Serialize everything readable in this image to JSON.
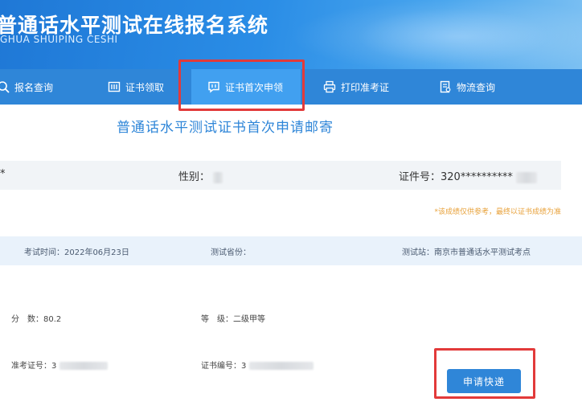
{
  "banner": {
    "title": "普通话水平测试在线报名系统",
    "subtitle": "GHUA SHUIPING CESHI"
  },
  "nav": {
    "items": [
      {
        "label": "报名查询",
        "icon": "search-icon"
      },
      {
        "label": "证书领取",
        "icon": "certificate-icon"
      },
      {
        "label": "证书首次申领",
        "icon": "message-icon",
        "active": true
      },
      {
        "label": "打印准考证",
        "icon": "printer-icon"
      },
      {
        "label": "物流查询",
        "icon": "document-icon"
      }
    ]
  },
  "page": {
    "title": "普通话水平测试证书首次申请邮寄"
  },
  "info": {
    "name_label": "*",
    "gender_label": "性别：",
    "id_label": "证件号：320**********"
  },
  "note": "*该成绩仅供参考，最终以证书成绩为准",
  "exam": {
    "time_label": "考试时间：",
    "time_value": "2022年06月23日",
    "province_label": "测试省份：",
    "station_label": "测试站：",
    "station_value": "南京市普通话水平测试考点"
  },
  "details": {
    "score_label": "分　数：",
    "score_value": "80.2",
    "grade_label": "等　级：",
    "grade_value": "二级甲等",
    "ticket_label": "准考证号：",
    "ticket_value": "3",
    "cert_label": "证书编号：",
    "cert_value": "3"
  },
  "apply_button": "申请快递",
  "colors": {
    "primary": "#2f86d8",
    "active_tab": "#41a0f0",
    "highlight": "#e23a3a",
    "note": "#e8a23b"
  }
}
